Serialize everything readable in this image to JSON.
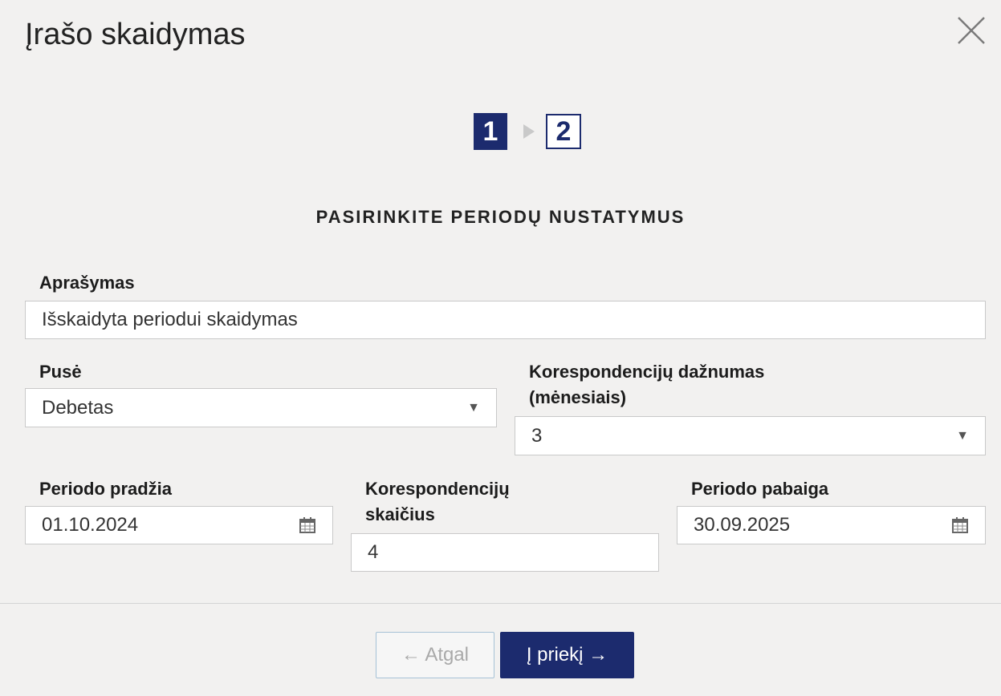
{
  "dialog": {
    "title": "Įrašo skaidymas",
    "close_icon": "close-icon"
  },
  "steps": {
    "items": [
      {
        "label": "1",
        "state": "active"
      },
      {
        "label": "2",
        "state": "inactive"
      }
    ],
    "separator_icon": "step-arrow-icon"
  },
  "section_title": "PASIRINKITE PERIODŲ NUSTATYMUS",
  "form": {
    "description": {
      "label": "Aprašymas",
      "value": "Išskaidyta periodui skaidymas"
    },
    "side": {
      "label": "Pusė",
      "value": "Debetas",
      "icon": "dropdown-caret-icon"
    },
    "frequency": {
      "label_line1": "Korespondencijų dažnumas",
      "label_line2": "(mėnesiais)",
      "value": "3",
      "icon": "dropdown-caret-icon"
    },
    "period_start": {
      "label": "Periodo pradžia",
      "value": "01.10.2024",
      "icon": "calendar-icon"
    },
    "count": {
      "label_line1": "Korespondencijų",
      "label_line2": "skaičius",
      "value": "4"
    },
    "period_end": {
      "label": "Periodo pabaiga",
      "value": "30.09.2025",
      "icon": "calendar-icon"
    }
  },
  "footer": {
    "back_label": "← Atgal",
    "forward_label": "Į priekį →"
  },
  "colors": {
    "primary": "#1c2b6e",
    "background": "#f2f1f0",
    "field_border": "#c9c9c9"
  }
}
